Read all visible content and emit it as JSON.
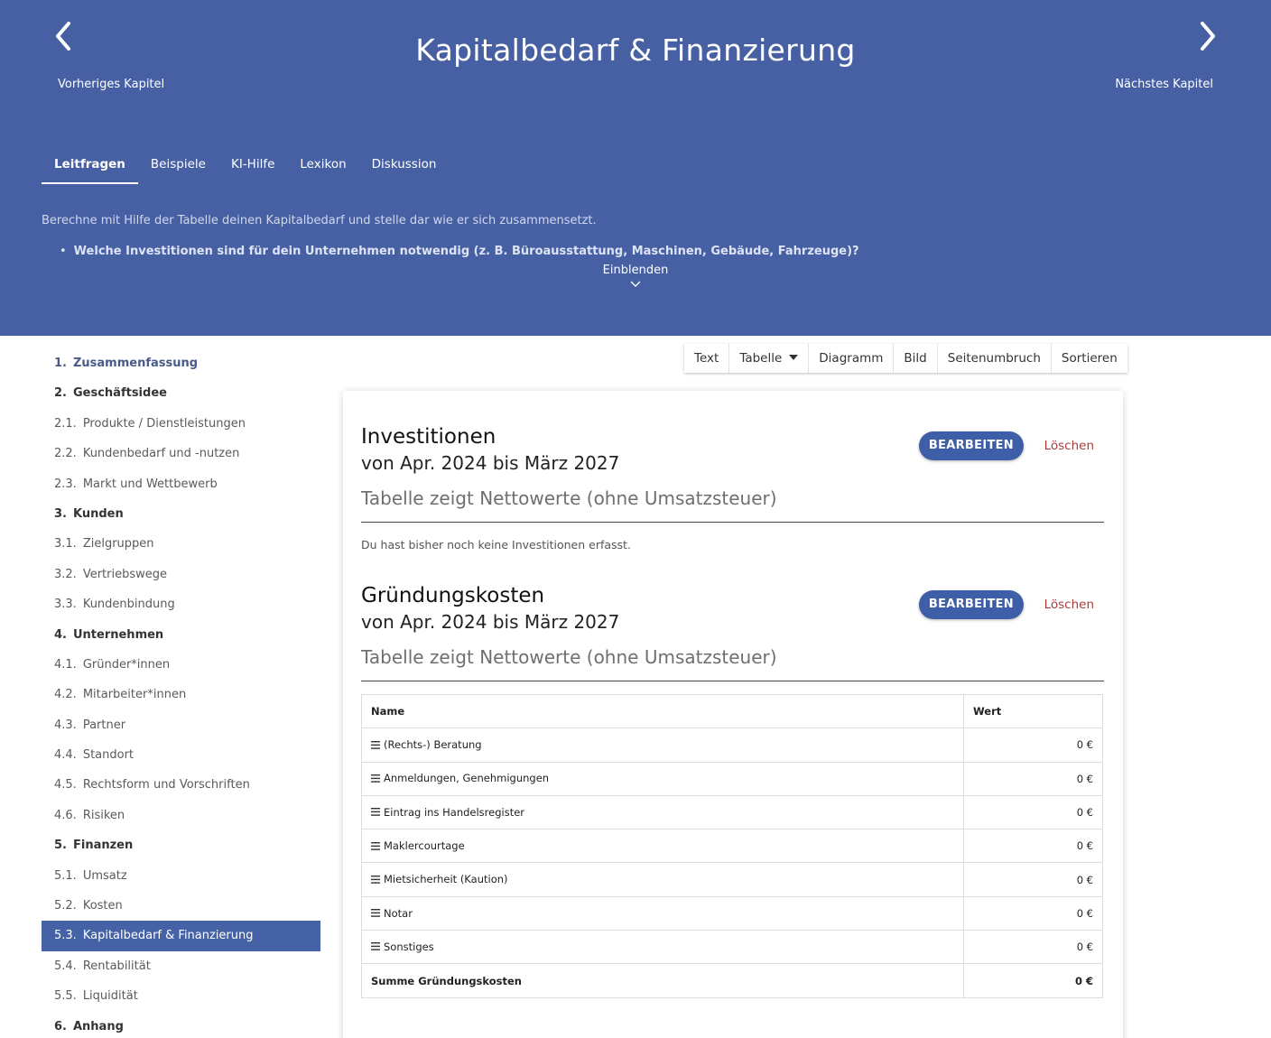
{
  "header": {
    "title": "Kapitalbedarf & Finanzierung",
    "prev_label": "Vorheriges Kapitel",
    "next_label": "Nächstes Kapitel",
    "tabs": [
      {
        "label": "Leitfragen",
        "active": true
      },
      {
        "label": "Beispiele"
      },
      {
        "label": "KI-Hilfe"
      },
      {
        "label": "Lexikon"
      },
      {
        "label": "Diskussion"
      }
    ],
    "description": "Berechne mit Hilfe der Tabelle deinen Kapitalbedarf und stelle dar wie er sich zusammensetzt.",
    "bullet": "Welche Investitionen sind für dein Unternehmen notwendig (z. B. Büroausstattung, Maschinen, Gebäude, Fahrzeuge)?",
    "expand_label": "Einblenden",
    "background_color": "#4760a3"
  },
  "sidebar": {
    "items": [
      {
        "num": "1.",
        "label": "Zusammenfassung",
        "level": "main"
      },
      {
        "num": "2.",
        "label": "Geschäftsidee",
        "level": "main"
      },
      {
        "num": "2.1.",
        "label": "Produkte / Dienstleistungen",
        "level": "sub"
      },
      {
        "num": "2.2.",
        "label": "Kundenbedarf und -nutzen",
        "level": "sub"
      },
      {
        "num": "2.3.",
        "label": "Markt und Wettbewerb",
        "level": "sub"
      },
      {
        "num": "3.",
        "label": "Kunden",
        "level": "main"
      },
      {
        "num": "3.1.",
        "label": "Zielgruppen",
        "level": "sub"
      },
      {
        "num": "3.2.",
        "label": "Vertriebswege",
        "level": "sub"
      },
      {
        "num": "3.3.",
        "label": "Kundenbindung",
        "level": "sub"
      },
      {
        "num": "4.",
        "label": "Unternehmen",
        "level": "main"
      },
      {
        "num": "4.1.",
        "label": "Gründer*innen",
        "level": "sub"
      },
      {
        "num": "4.2.",
        "label": "Mitarbeiter*innen",
        "level": "sub"
      },
      {
        "num": "4.3.",
        "label": "Partner",
        "level": "sub"
      },
      {
        "num": "4.4.",
        "label": "Standort",
        "level": "sub"
      },
      {
        "num": "4.5.",
        "label": "Rechtsform und Vorschriften",
        "level": "sub"
      },
      {
        "num": "4.6.",
        "label": "Risiken",
        "level": "sub"
      },
      {
        "num": "5.",
        "label": "Finanzen",
        "level": "main"
      },
      {
        "num": "5.1.",
        "label": "Umsatz",
        "level": "sub"
      },
      {
        "num": "5.2.",
        "label": "Kosten",
        "level": "sub"
      },
      {
        "num": "5.3.",
        "label": "Kapitalbedarf & Finanzierung",
        "level": "sub",
        "active": true
      },
      {
        "num": "5.4.",
        "label": "Rentabilität",
        "level": "sub"
      },
      {
        "num": "5.5.",
        "label": "Liquidität",
        "level": "sub"
      },
      {
        "num": "6.",
        "label": "Anhang",
        "level": "main"
      }
    ],
    "active_color": "#4562a6"
  },
  "toolbar": {
    "text": "Text",
    "table": "Tabelle",
    "chart": "Diagramm",
    "image": "Bild",
    "pagebreak": "Seitenumbruch",
    "sort": "Sortieren"
  },
  "investments": {
    "title": "Investitionen",
    "period": "von Apr. 2024 bis März 2027",
    "note": "Tabelle zeigt Nettowerte (ohne Umsatzsteuer)",
    "edit_label": "BEARBEITEN",
    "delete_label": "Löschen",
    "empty_message": "Du hast bisher noch keine Investitionen erfasst."
  },
  "founding_costs": {
    "title": "Gründungskosten",
    "period": "von Apr. 2024 bis März 2027",
    "note": "Tabelle zeigt Nettowerte (ohne Umsatzsteuer)",
    "edit_label": "BEARBEITEN",
    "delete_label": "Löschen",
    "columns": [
      "Name",
      "Wert"
    ],
    "rows": [
      {
        "name": "(Rechts-) Beratung",
        "value": "0 €"
      },
      {
        "name": "Anmeldungen, Genehmigungen",
        "value": "0 €"
      },
      {
        "name": "Eintrag ins Handelsregister",
        "value": "0 €"
      },
      {
        "name": "Maklercourtage",
        "value": "0 €"
      },
      {
        "name": "Mietsicherheit (Kaution)",
        "value": "0 €"
      },
      {
        "name": "Notar",
        "value": "0 €"
      },
      {
        "name": "Sonstiges",
        "value": "0 €"
      }
    ],
    "sum": {
      "name": "Summe Gründungskosten",
      "value": "0 €"
    }
  },
  "colors": {
    "primary_button": "#3e5fa8",
    "delete_text": "#a83c3c"
  }
}
